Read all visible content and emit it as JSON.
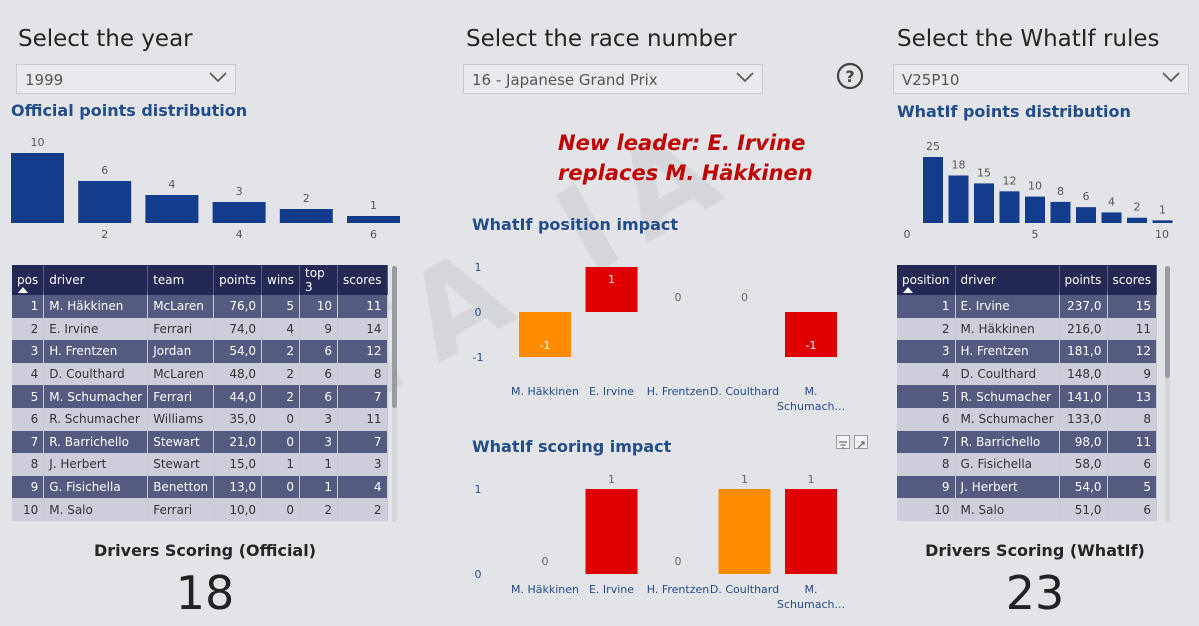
{
  "watermark": "DATA IA",
  "left": {
    "heading": "Select the year",
    "dropdown_value": "1999",
    "dist_title": "Official points distribution",
    "dist_chart": {
      "type": "bar",
      "values": [
        10,
        6,
        4,
        3,
        2,
        1
      ],
      "x_ticks": [
        "2",
        "4",
        "6"
      ],
      "color": "#143c8c"
    },
    "table": {
      "columns": [
        "pos",
        "driver",
        "team",
        "points",
        "wins",
        "top 3",
        "scores"
      ],
      "rows": [
        [
          "1",
          "M. Häkkinen",
          "McLaren",
          "76,0",
          "5",
          "10",
          "11"
        ],
        [
          "2",
          "E. Irvine",
          "Ferrari",
          "74,0",
          "4",
          "9",
          "14"
        ],
        [
          "3",
          "H. Frentzen",
          "Jordan",
          "54,0",
          "2",
          "6",
          "12"
        ],
        [
          "4",
          "D. Coulthard",
          "McLaren",
          "48,0",
          "2",
          "6",
          "8"
        ],
        [
          "5",
          "M. Schumacher",
          "Ferrari",
          "44,0",
          "2",
          "6",
          "7"
        ],
        [
          "6",
          "R. Schumacher",
          "Williams",
          "35,0",
          "0",
          "3",
          "11"
        ],
        [
          "7",
          "R. Barrichello",
          "Stewart",
          "21,0",
          "0",
          "3",
          "7"
        ],
        [
          "8",
          "J. Herbert",
          "Stewart",
          "15,0",
          "1",
          "1",
          "3"
        ],
        [
          "9",
          "G. Fisichella",
          "Benetton",
          "13,0",
          "0",
          "1",
          "4"
        ],
        [
          "10",
          "M. Salo",
          "Ferrari",
          "10,0",
          "0",
          "2",
          "2"
        ]
      ]
    },
    "scoring_label": "Drivers Scoring (Official)",
    "scoring_value": "18"
  },
  "center": {
    "heading": "Select the race number",
    "dropdown_value": "16 - Japanese Grand Prix",
    "help_icon": "question-circle-icon",
    "leader_line1": "New leader: E. Irvine",
    "leader_line2": "replaces M. Häkkinen",
    "position_title": "WhatIf position impact",
    "position_chart": {
      "type": "bar",
      "categories": [
        "M. Häkkinen",
        "E. Irvine",
        "H. Frentzen",
        "D. Coulthard",
        "M. Schumach..."
      ],
      "values": [
        -1,
        1,
        0,
        0,
        -1
      ],
      "colors": [
        "#ff8c00",
        "#e00000",
        "#e00000",
        "#e00000",
        "#e00000"
      ],
      "y_ticks": [
        "1",
        "0",
        "-1"
      ],
      "ylim": [
        -1,
        1
      ]
    },
    "scoring_title": "WhatIf scoring impact",
    "scoring_chart": {
      "type": "bar",
      "categories": [
        "M. Häkkinen",
        "E. Irvine",
        "H. Frentzen",
        "D. Coulthard",
        "M. Schumach..."
      ],
      "values": [
        0,
        1,
        0,
        1,
        1
      ],
      "colors": [
        "#e00000",
        "#e00000",
        "#e00000",
        "#ff8c00",
        "#e00000"
      ],
      "y_ticks": [
        "1",
        "0"
      ],
      "ylim": [
        0,
        1
      ]
    }
  },
  "right": {
    "heading": "Select the WhatIf rules",
    "dropdown_value": "V25P10",
    "dist_title": "WhatIf points distribution",
    "dist_chart": {
      "type": "bar",
      "values": [
        25,
        18,
        15,
        12,
        10,
        8,
        6,
        4,
        2,
        1
      ],
      "x_ticks": [
        "0",
        "5",
        "10"
      ],
      "color": "#143c8c"
    },
    "table": {
      "columns": [
        "position",
        "driver",
        "points",
        "scores"
      ],
      "rows": [
        [
          "1",
          "E. Irvine",
          "237,0",
          "15"
        ],
        [
          "2",
          "M. Häkkinen",
          "216,0",
          "11"
        ],
        [
          "3",
          "H. Frentzen",
          "181,0",
          "12"
        ],
        [
          "4",
          "D. Coulthard",
          "148,0",
          "9"
        ],
        [
          "5",
          "R. Schumacher",
          "141,0",
          "13"
        ],
        [
          "6",
          "M. Schumacher",
          "133,0",
          "8"
        ],
        [
          "7",
          "R. Barrichello",
          "98,0",
          "11"
        ],
        [
          "8",
          "G. Fisichella",
          "58,0",
          "6"
        ],
        [
          "9",
          "J. Herbert",
          "54,0",
          "5"
        ],
        [
          "10",
          "M. Salo",
          "51,0",
          "6"
        ]
      ]
    },
    "scoring_label": "Drivers Scoring (WhatIf)",
    "scoring_value": "23"
  },
  "chart_data": [
    {
      "type": "bar",
      "name": "Official points distribution",
      "categories": [
        "1",
        "2",
        "3",
        "4",
        "5",
        "6"
      ],
      "values": [
        10,
        6,
        4,
        3,
        2,
        1
      ]
    },
    {
      "type": "bar",
      "name": "WhatIf points distribution",
      "categories": [
        "1",
        "2",
        "3",
        "4",
        "5",
        "6",
        "7",
        "8",
        "9",
        "10"
      ],
      "values": [
        25,
        18,
        15,
        12,
        10,
        8,
        6,
        4,
        2,
        1
      ]
    },
    {
      "type": "bar",
      "name": "WhatIf position impact",
      "categories": [
        "M. Häkkinen",
        "E. Irvine",
        "H. Frentzen",
        "D. Coulthard",
        "M. Schumach..."
      ],
      "values": [
        -1,
        1,
        0,
        0,
        -1
      ],
      "ylim": [
        -1,
        1
      ]
    },
    {
      "type": "bar",
      "name": "WhatIf scoring impact",
      "categories": [
        "M. Häkkinen",
        "E. Irvine",
        "H. Frentzen",
        "D. Coulthard",
        "M. Schumach..."
      ],
      "values": [
        0,
        1,
        0,
        1,
        1
      ],
      "ylim": [
        0,
        1
      ]
    }
  ]
}
